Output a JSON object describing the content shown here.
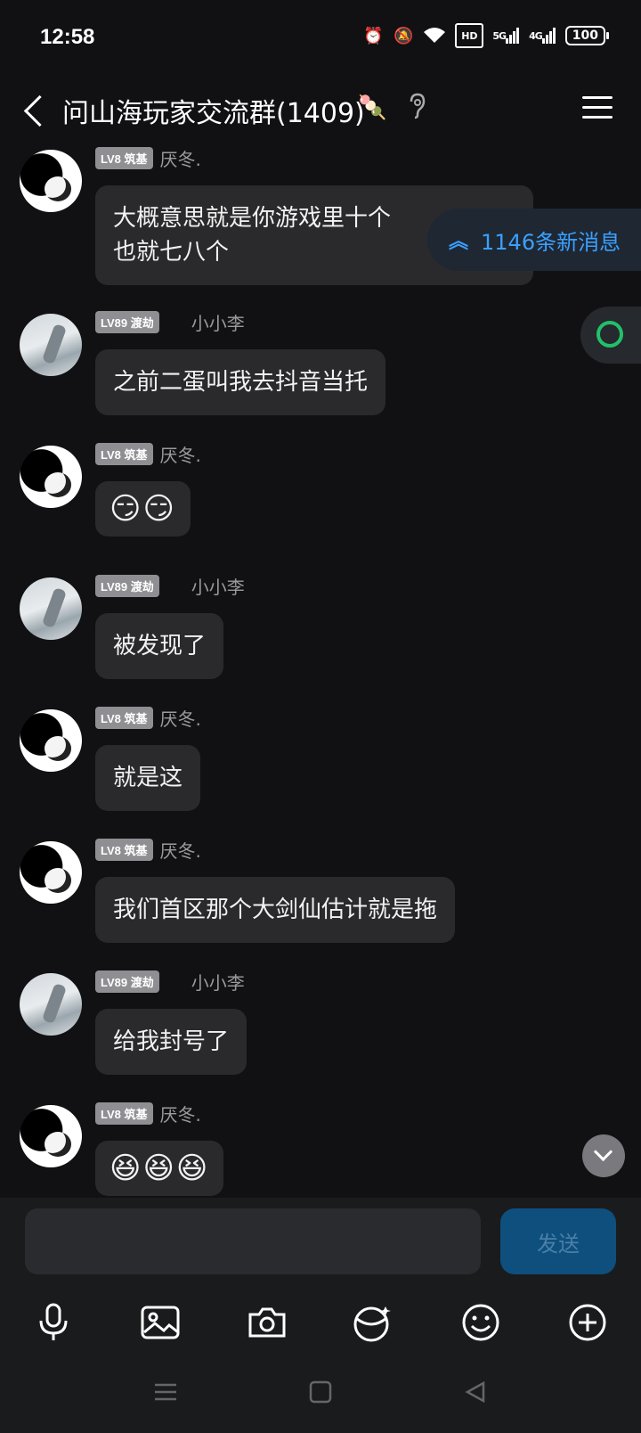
{
  "status": {
    "time": "12:58",
    "icons": [
      "alarm-icon",
      "mute-bell-icon",
      "wifi-icon",
      "hd-icon",
      "5g-signal-icon",
      "4g-signal-icon",
      "battery-icon"
    ],
    "hd_label": "HD",
    "sig1": "5G",
    "sig2": "4G",
    "battery": "100"
  },
  "header": {
    "title": "问山海玩家交流群(1409)",
    "emoji": "🍡"
  },
  "new_messages": "1146条新消息",
  "messages": [
    {
      "level": "LV8 筑基",
      "nick": "厌冬.",
      "text": "大概意思就是你游戏里十个",
      "text2": "也就七八个"
    },
    {
      "level": "LV89 渡劫",
      "nick": "小小李",
      "text": "之前二蛋叫我去抖音当托"
    },
    {
      "level": "LV8 筑基",
      "nick": "厌冬.",
      "text": "😏😏"
    },
    {
      "level": "LV89 渡劫",
      "nick": "小小李",
      "text": "被发现了"
    },
    {
      "level": "LV8 筑基",
      "nick": "厌冬.",
      "text": "就是这"
    },
    {
      "level": "LV8 筑基",
      "nick": "厌冬.",
      "text": "我们首区那个大剑仙估计就是拖"
    },
    {
      "level": "LV89 渡劫",
      "nick": "小小李",
      "text": "给我封号了"
    },
    {
      "level": "LV8 筑基",
      "nick": "厌冬.",
      "text": "😆😆😆"
    }
  ],
  "input": {
    "placeholder": "",
    "send_label": "发送"
  },
  "colors": {
    "background": "#111113",
    "bubble": "#2a2a2c",
    "accent": "#3aa0ff",
    "send": "#0e4f7e"
  }
}
